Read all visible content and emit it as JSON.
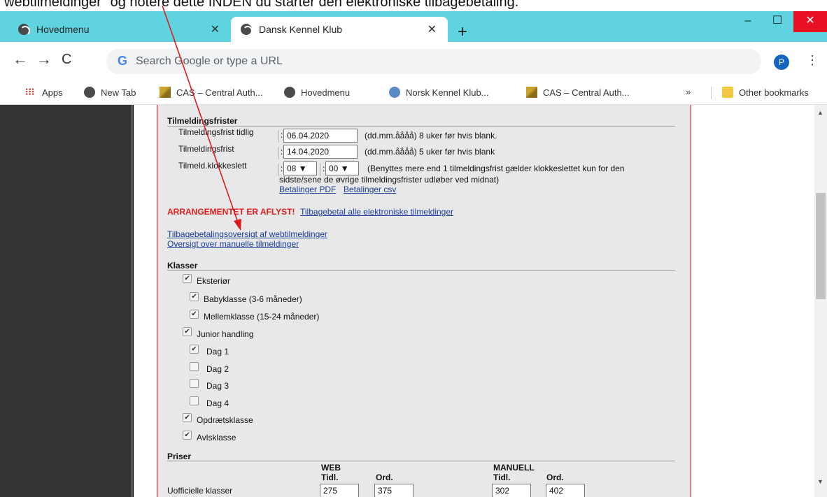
{
  "doc_caption": "webtilmeldinger\" og notere dette INDEN du starter den elektroniske tilbagebetaling.",
  "browser": {
    "tabs": [
      {
        "title": "Hovedmenu",
        "active": false
      },
      {
        "title": "Dansk Kennel Klub",
        "active": true
      }
    ],
    "newtab_symbol": "+",
    "window_controls": {
      "minimize": "–",
      "maximize": "☐",
      "close": "✕"
    },
    "omnibox_placeholder": "Search Google or type a URL",
    "profile_initial": "P",
    "bookmarks": [
      "Apps",
      "New Tab",
      "CAS – Central Auth...",
      "Hovedmenu",
      "Norsk Kennel Klub...",
      "CAS – Central Auth..."
    ],
    "bookmarks_overflow": "»",
    "other_bookmarks": "Other bookmarks"
  },
  "deadlines": {
    "title": "Tilmeldingsfrister",
    "early_label": "Tilmeldingsfrist tidlig",
    "early_value": "06.04.2020",
    "early_hint": "(dd.mm.åååå)  8 uker før hvis blank.",
    "regular_label": "Tilmeldingsfrist",
    "regular_value": "14.04.2020",
    "regular_hint": "(dd.mm.åååå)  5 uker før hvis blank",
    "time_label": "Tilmeld.klokkeslett",
    "hour": "08",
    "minute": "00",
    "time_hint_1": "(Benyttes mere end 1 tilmeldingsfrist gælder klokkeslettet kun for den",
    "time_hint_2": "sidste/sene de øvrige tilmeldingsfrister udløber ved midnat)",
    "payments_pdf": "Betalinger PDF",
    "payments_csv": "Betalinger csv"
  },
  "cancel": {
    "notice": "ARRANGEMENTET ER AFLYST!",
    "refund_all_link": "Tilbagebetal alle elektroniske tilmeldinger",
    "refund_overview_link": "Tilbagebetalingsoversigt af webtilmeldinger",
    "manual_overview_link": "Oversigt over manuelle tilmeldinger"
  },
  "classes": {
    "title": "Klasser",
    "items": [
      {
        "label": "Eksteriør",
        "checked": true
      },
      {
        "label": "Babyklasse (3-6 måneder)",
        "checked": true
      },
      {
        "label": "Mellemklasse (15-24 måneder)",
        "checked": true
      },
      {
        "label": "Junior handling",
        "checked": true
      },
      {
        "label": "Dag 1",
        "checked": true
      },
      {
        "label": "Dag 2",
        "checked": false
      },
      {
        "label": "Dag 3",
        "checked": false
      },
      {
        "label": "Dag 4",
        "checked": false
      },
      {
        "label": "Opdrætsklasse",
        "checked": true
      },
      {
        "label": "Avlsklasse",
        "checked": true
      }
    ]
  },
  "prices": {
    "title": "Priser",
    "web_header": "WEB",
    "manual_header": "MANUELL",
    "early_col": "Tidl.",
    "ord_col": "Ord.",
    "row_label": "Uofficielle klasser",
    "web_early": "275",
    "web_ord": "375",
    "manual_early": "302",
    "manual_ord": "402"
  },
  "checkmark": "✔",
  "scroll_up": "▲",
  "scroll_down": "▼"
}
